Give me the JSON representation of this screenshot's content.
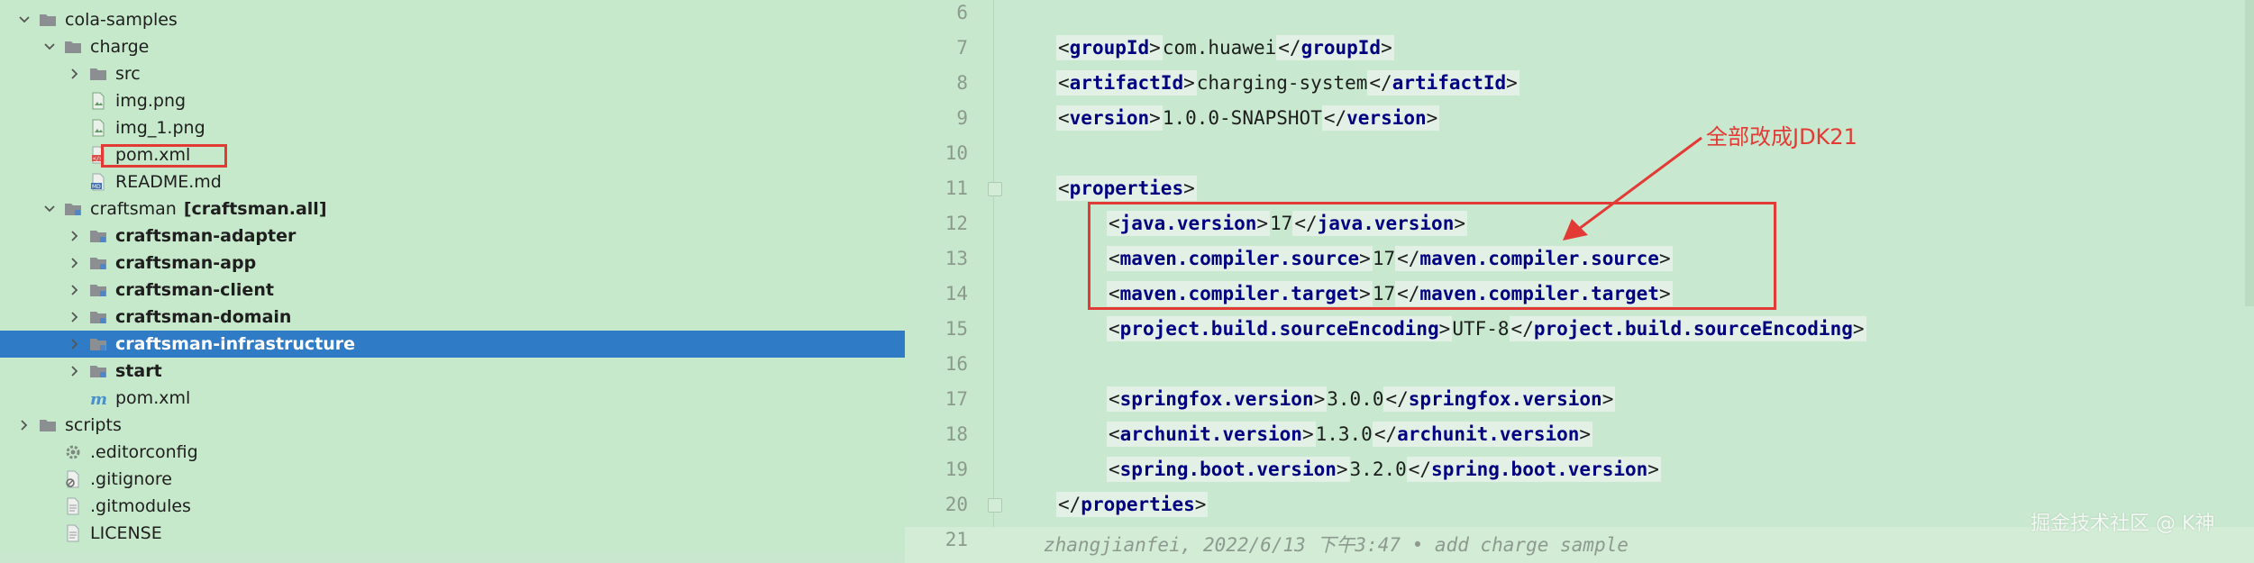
{
  "tree": {
    "items": [
      {
        "label": "cola-samples",
        "icon": "folder-icon",
        "expanded": true,
        "indent": 1
      },
      {
        "label": "charge",
        "icon": "folder-icon",
        "expanded": true,
        "indent": 2
      },
      {
        "label": "src",
        "icon": "folder-icon",
        "expanded": false,
        "indent": 3
      },
      {
        "label": "img.png",
        "icon": "image-file-icon",
        "indent": 3
      },
      {
        "label": "img_1.png",
        "icon": "image-file-icon",
        "indent": 3
      },
      {
        "label": "pom.xml",
        "icon": "xml-file-icon",
        "indent": 3
      },
      {
        "label": "README.md",
        "icon": "markdown-file-icon",
        "indent": 3
      },
      {
        "label": "craftsman",
        "sublabel": "[craftsman.all]",
        "icon": "module-folder-icon",
        "expanded": true,
        "indent": 2
      },
      {
        "label": "craftsman-adapter",
        "icon": "module-folder-icon",
        "expanded": false,
        "indent": 3,
        "bold": true
      },
      {
        "label": "craftsman-app",
        "icon": "module-folder-icon",
        "expanded": false,
        "indent": 3,
        "bold": true
      },
      {
        "label": "craftsman-client",
        "icon": "module-folder-icon",
        "expanded": false,
        "indent": 3,
        "bold": true
      },
      {
        "label": "craftsman-domain",
        "icon": "module-folder-icon",
        "expanded": false,
        "indent": 3,
        "bold": true
      },
      {
        "label": "craftsman-infrastructure",
        "icon": "module-folder-icon",
        "expanded": false,
        "indent": 3,
        "bold": true,
        "selected": true
      },
      {
        "label": "start",
        "icon": "module-folder-icon",
        "expanded": false,
        "indent": 3,
        "bold": true
      },
      {
        "label": "pom.xml",
        "icon": "maven-file-icon",
        "indent": 3
      },
      {
        "label": "scripts",
        "icon": "folder-icon",
        "expanded": false,
        "indent": 1
      },
      {
        "label": ".editorconfig",
        "icon": "gear-icon",
        "indent": 2
      },
      {
        "label": ".gitignore",
        "icon": "gitignore-file-icon",
        "indent": 2
      },
      {
        "label": ".gitmodules",
        "icon": "text-file-icon",
        "indent": 2
      },
      {
        "label": "LICENSE",
        "icon": "text-file-icon",
        "indent": 2
      }
    ]
  },
  "editor": {
    "lines": [
      {
        "n": "6",
        "indent": 0,
        "tag": "",
        "value": "",
        "close": ""
      },
      {
        "n": "7",
        "indent": 1,
        "tag": "groupId",
        "value": "com.huawei",
        "close": "groupId"
      },
      {
        "n": "8",
        "indent": 1,
        "tag": "artifactId",
        "value": "charging-system",
        "close": "artifactId"
      },
      {
        "n": "9",
        "indent": 1,
        "tag": "version",
        "value": "1.0.0-SNAPSHOT",
        "close": "version"
      },
      {
        "n": "10",
        "indent": 0,
        "tag": "",
        "value": "",
        "close": ""
      },
      {
        "n": "11",
        "indent": 1,
        "tag": "properties",
        "value": "",
        "close": "",
        "fold": true
      },
      {
        "n": "12",
        "indent": 2,
        "tag": "java.version",
        "value": "17",
        "close": "java.version"
      },
      {
        "n": "13",
        "indent": 2,
        "tag": "maven.compiler.source",
        "value": "17",
        "close": "maven.compiler.source"
      },
      {
        "n": "14",
        "indent": 2,
        "tag": "maven.compiler.target",
        "value": "17",
        "close": "maven.compiler.target"
      },
      {
        "n": "15",
        "indent": 2,
        "tag": "project.build.sourceEncoding",
        "value": "UTF-8",
        "close": "project.build.sourceEncoding"
      },
      {
        "n": "16",
        "indent": 0,
        "tag": "",
        "value": "",
        "close": ""
      },
      {
        "n": "17",
        "indent": 2,
        "tag": "springfox.version",
        "value": "3.0.0",
        "close": "springfox.version"
      },
      {
        "n": "18",
        "indent": 2,
        "tag": "archunit.version",
        "value": "1.3.0",
        "close": "archunit.version"
      },
      {
        "n": "19",
        "indent": 2,
        "tag": "spring.boot.version",
        "value": "3.2.0",
        "close": "spring.boot.version"
      },
      {
        "n": "20",
        "indent": 1,
        "tag": "",
        "value": "",
        "close": "properties",
        "fold": true
      },
      {
        "n": "21",
        "indent": 0,
        "tag": "",
        "value": "",
        "close": ""
      }
    ],
    "blame": "zhangjianfei, 2022/6/13 下午3:47 • add charge sample"
  },
  "annotation": {
    "text": "全部改成JDK21",
    "color": "#e23b35"
  },
  "watermark": "掘金技术社区 @ K神",
  "colors": {
    "tree_bg": "#c7e9cb",
    "selected_bg": "#2f7bc6",
    "tag": "#000080",
    "highlight_red": "#e23b35"
  }
}
